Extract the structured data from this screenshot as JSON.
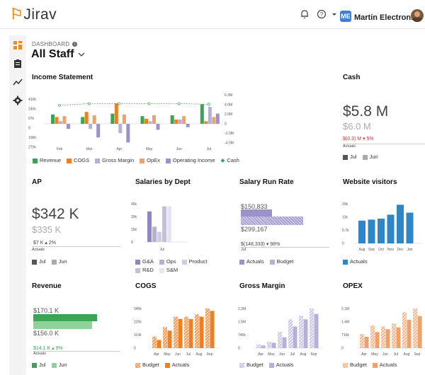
{
  "app": {
    "logo": "Jirav"
  },
  "org": {
    "badge": "ME",
    "name": "Martin Electronics"
  },
  "breadcrumb": "DASHBOARD",
  "page_title": "All Staff",
  "colors": {
    "revenue": "#3aa655",
    "cogs": "#f07f22",
    "gross_margin": "#b6b0d9",
    "opex": "#f0a06a",
    "operating_income": "#9b92c9",
    "cash": "#3aa655",
    "blue": "#2f86c6",
    "gray": "#555555",
    "lightgray": "#aaaaaa",
    "bars_green": "#3aa655",
    "bars_lightgreen": "#8fd39a"
  },
  "panels": {
    "income_statement": {
      "title": "Income Statement",
      "legend": [
        "Revenue",
        "COGS",
        "Gross Margin",
        "OpEx",
        "Operating Income",
        "Cash"
      ]
    },
    "cash": {
      "title": "Cash",
      "value": "$5.8 M",
      "prior": "$6.0 M",
      "delta": "$(0.3) M",
      "delta_pct": "5%",
      "actuals": "Actuals",
      "legend": [
        "Jul",
        "Jun"
      ]
    },
    "ap": {
      "title": "AP",
      "value": "$342 K",
      "prior": "$335 K",
      "delta": "$7 K",
      "delta_pct": "2%",
      "actuals": "Actuals",
      "legend": [
        "Jul",
        "Jun"
      ]
    },
    "salaries": {
      "title": "Salaries by Dept",
      "x_label": "Jul",
      "legend": [
        "G&A",
        "Ops",
        "Product",
        "R&D",
        "S&M"
      ]
    },
    "salary_run_rate": {
      "title": "Salary Run Rate",
      "top_value": "$150,833",
      "bottom_value": "$299,167",
      "delta": "$(148,333)",
      "delta_pct": "98%",
      "x_label": "Jul",
      "legend": [
        "Actuals",
        "Budget"
      ]
    },
    "website_visitors": {
      "title": "Website visitors",
      "legend": [
        "Actuals"
      ]
    },
    "revenue": {
      "title": "Revenue",
      "top_value": "$170.1 K",
      "bottom_value": "$156.0 K",
      "delta": "$14.1 K",
      "delta_pct": "9%",
      "actuals": "Actuals",
      "legend": [
        "Jul",
        "Jun"
      ]
    },
    "cogs": {
      "title": "COGS",
      "legend": [
        "Budget",
        "Actuals"
      ]
    },
    "gross_margin": {
      "title": "Gross Margin",
      "legend": [
        "Budget",
        "Actuals"
      ]
    },
    "opex": {
      "title": "OPEX",
      "legend": [
        "Budget",
        "Actuals"
      ]
    }
  },
  "chart_data": [
    {
      "type": "bar",
      "title": "Income Statement",
      "categories": [
        "Feb",
        "Mar",
        "Apr",
        "May",
        "Jun",
        "Jul"
      ],
      "left_ticks": [
        "410k",
        "240k",
        "67k",
        "0",
        "100k",
        "270k"
      ],
      "right_ticks": [
        "6.3M",
        "4.0M",
        "2.0M",
        "0",
        "-2.0M",
        "-4.0M"
      ],
      "series": [
        {
          "name": "Revenue",
          "values": [
            110,
            80,
            120,
            90,
            100,
            230
          ]
        },
        {
          "name": "COGS",
          "values": [
            80,
            140,
            240,
            60,
            50,
            30
          ]
        },
        {
          "name": "Gross Margin",
          "values": [
            30,
            -60,
            -110,
            30,
            50,
            200
          ]
        },
        {
          "name": "OpEx",
          "values": [
            90,
            100,
            110,
            100,
            90,
            80
          ]
        },
        {
          "name": "Operating Income",
          "values": [
            -60,
            -160,
            -220,
            -70,
            -40,
            120
          ]
        },
        {
          "name": "Cash",
          "values": [
            5.5,
            6.0,
            6.0,
            6.0,
            6.0,
            5.8
          ]
        }
      ]
    },
    {
      "type": "bar",
      "title": "Salaries by Dept",
      "categories": [
        "Jul"
      ],
      "y_ticks": [
        "45k",
        "30k",
        "15k",
        "0"
      ],
      "series": [
        {
          "name": "G&A",
          "values": [
            36
          ]
        },
        {
          "name": "Ops",
          "values": [
            18
          ]
        },
        {
          "name": "Product",
          "values": [
            12
          ]
        },
        {
          "name": "R&D",
          "values": [
            42
          ]
        },
        {
          "name": "S&M",
          "values": [
            42
          ]
        }
      ]
    },
    {
      "type": "bar",
      "title": "Website visitors",
      "categories": [
        "Aug",
        "Sep",
        "Oct",
        "Nov",
        "Dec",
        "Jan"
      ],
      "y_ticks": [
        "20k",
        "13k",
        "6.7k",
        "0"
      ],
      "series": [
        {
          "name": "Actuals",
          "values": [
            11.5,
            12.0,
            12.5,
            14.5,
            19.5,
            15.5
          ]
        }
      ]
    },
    {
      "type": "bar",
      "title": "COGS",
      "categories": [
        "Apr",
        "May",
        "Jun",
        "Jul",
        "Aug",
        "Sep"
      ],
      "y_ticks": [
        "340k",
        "220k",
        "110k",
        "0"
      ],
      "series": [
        {
          "name": "Budget",
          "values": [
            100,
            180,
            270,
            270,
            290,
            340
          ]
        },
        {
          "name": "Actuals",
          "values": [
            70,
            150,
            250,
            250,
            270,
            320
          ]
        }
      ]
    },
    {
      "type": "bar",
      "title": "Gross Margin",
      "categories": [
        "Apr",
        "May",
        "Jun",
        "Jul",
        "Aug",
        "Sep"
      ],
      "y_ticks": [
        "2.2M",
        "1.5M",
        "740k",
        "0"
      ],
      "series": [
        {
          "name": "Budget",
          "values": [
            0.2,
            0.35,
            0.9,
            1.6,
            1.8,
            2.2
          ]
        },
        {
          "name": "Actuals",
          "values": [
            0.15,
            0.3,
            0.6,
            1.2,
            1.6,
            1.9
          ]
        }
      ]
    },
    {
      "type": "bar",
      "title": "OPEX",
      "categories": [
        "Apr",
        "May",
        "Jun",
        "Jul",
        "Aug",
        "Sep"
      ],
      "y_ticks": [
        "2.1M",
        "1.4M",
        "710k",
        "0"
      ],
      "series": [
        {
          "name": "Budget",
          "values": [
            0.75,
            1.2,
            1.15,
            1.3,
            1.9,
            2.1
          ]
        },
        {
          "name": "Actuals",
          "values": [
            0.6,
            0.85,
            1.0,
            1.1,
            1.5,
            1.7
          ]
        }
      ]
    }
  ]
}
